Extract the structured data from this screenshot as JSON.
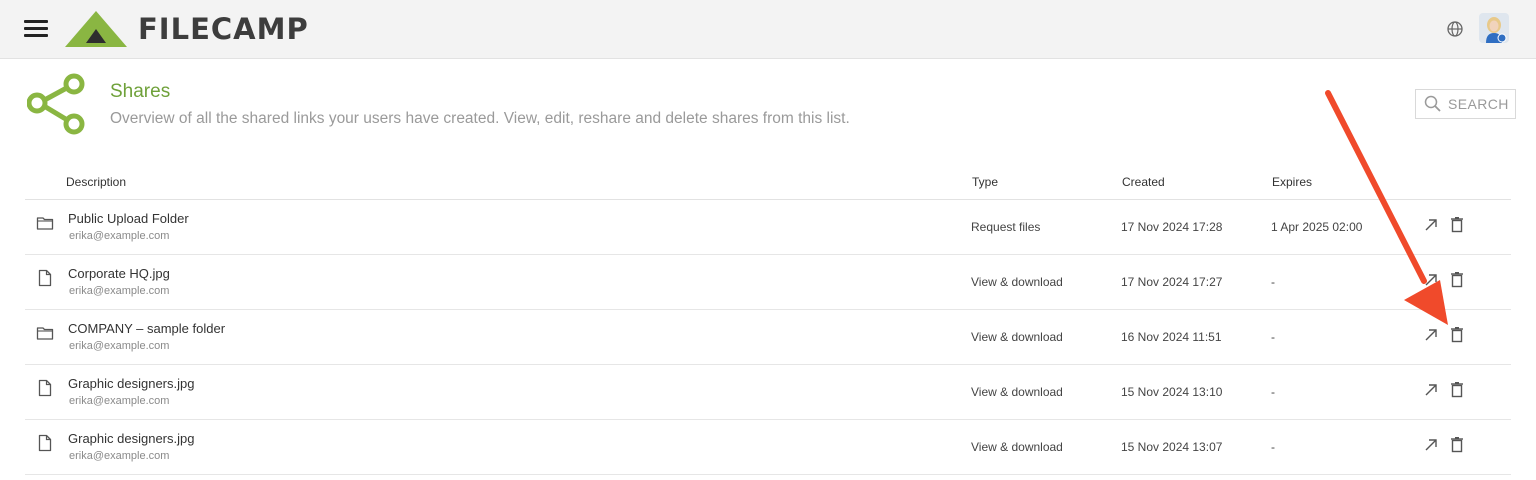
{
  "app": {
    "logo_text": "FILECAMP",
    "brand_color": "#8ab642",
    "accent_color": "#6fa13a",
    "annotation_color": "#f04a2b"
  },
  "topbar": {
    "menu_icon": "hamburger-icon",
    "language_icon": "globe-icon",
    "avatar_icon": "user-avatar"
  },
  "header": {
    "icon": "share-icon",
    "title": "Shares",
    "subtitle": "Overview of all the shared links your users have created. View, edit, reshare and delete shares from this list."
  },
  "search": {
    "label": "SEARCH",
    "icon": "search-icon"
  },
  "table": {
    "columns": {
      "description": "Description",
      "type": "Type",
      "created": "Created",
      "expires": "Expires"
    },
    "rows": [
      {
        "icon": "folder-icon",
        "name": "Public Upload Folder",
        "email": "erika@example.com",
        "type": "Request files",
        "created": "17 Nov 2024 17:28",
        "expires": "1 Apr 2025 02:00"
      },
      {
        "icon": "file-icon",
        "name": "Corporate HQ.jpg",
        "email": "erika@example.com",
        "type": "View & download",
        "created": "17 Nov 2024 17:27",
        "expires": "-"
      },
      {
        "icon": "folder-icon",
        "name": "COMPANY – sample folder",
        "email": "erika@example.com",
        "type": "View & download",
        "created": "16 Nov 2024 11:51",
        "expires": "-"
      },
      {
        "icon": "file-icon",
        "name": "Graphic designers.jpg",
        "email": "erika@example.com",
        "type": "View & download",
        "created": "15 Nov 2024 13:10",
        "expires": "-"
      },
      {
        "icon": "file-icon",
        "name": "Graphic designers.jpg",
        "email": "erika@example.com",
        "type": "View & download",
        "created": "15 Nov 2024 13:07",
        "expires": "-"
      }
    ],
    "row_actions": [
      "open-share-icon",
      "delete-icon"
    ]
  }
}
